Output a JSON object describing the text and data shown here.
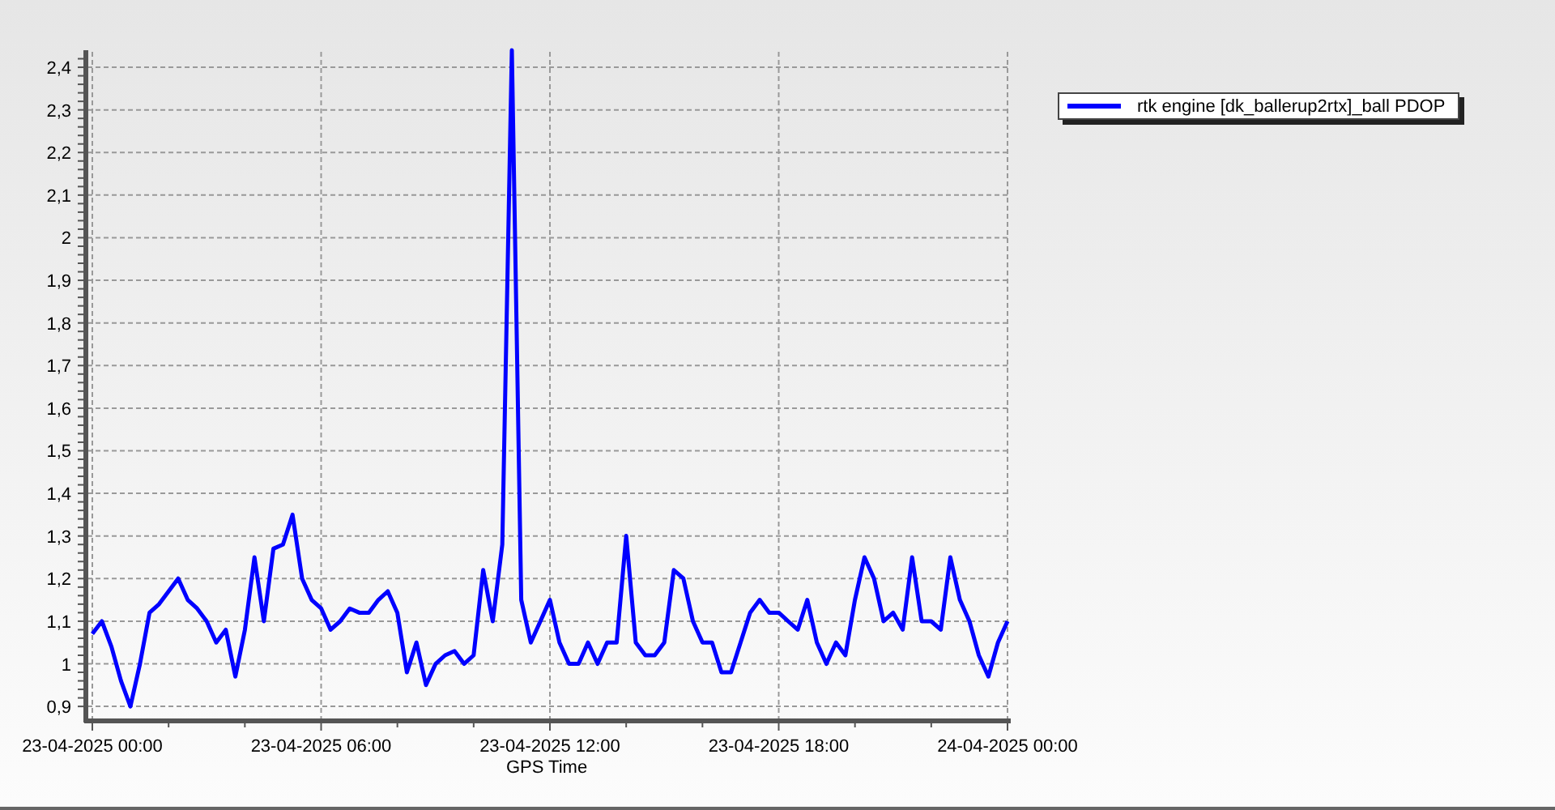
{
  "chart_data": {
    "type": "line",
    "xlabel": "GPS Time",
    "grid": true,
    "categories": [
      "23-04-2025 00:00",
      null,
      null,
      null,
      null,
      null,
      null,
      null,
      null,
      null,
      null,
      null,
      null,
      null,
      null,
      null,
      null,
      null,
      null,
      null,
      null,
      null,
      null,
      null,
      "23-04-2025 06:00",
      null,
      null,
      null,
      null,
      null,
      null,
      null,
      null,
      null,
      null,
      null,
      null,
      null,
      null,
      null,
      null,
      null,
      null,
      null,
      null,
      null,
      null,
      null,
      "23-04-2025 12:00",
      null,
      null,
      null,
      null,
      null,
      null,
      null,
      null,
      null,
      null,
      null,
      null,
      null,
      null,
      null,
      null,
      null,
      null,
      null,
      null,
      null,
      null,
      null,
      "23-04-2025 18:00",
      null,
      null,
      null,
      null,
      null,
      null,
      null,
      null,
      null,
      null,
      null,
      null,
      null,
      null,
      null,
      null,
      null,
      null,
      null,
      null,
      null,
      null,
      null,
      "24-04-2025 00:00"
    ],
    "yticks": [
      {
        "value": 0.9,
        "label": "0,9"
      },
      {
        "value": 1,
        "label": "1"
      },
      {
        "value": 1.1,
        "label": "1,1"
      },
      {
        "value": 1.2,
        "label": "1,2"
      },
      {
        "value": 1.3,
        "label": "1,3"
      },
      {
        "value": 1.4,
        "label": "1,4"
      },
      {
        "value": 1.5,
        "label": "1,5"
      },
      {
        "value": 1.6,
        "label": "1,6"
      },
      {
        "value": 1.7,
        "label": "1,7"
      },
      {
        "value": 1.8,
        "label": "1,8"
      },
      {
        "value": 1.9,
        "label": "1,9"
      },
      {
        "value": 2,
        "label": "2"
      },
      {
        "value": 2.1,
        "label": "2,1"
      },
      {
        "value": 2.2,
        "label": "2,2"
      },
      {
        "value": 2.3,
        "label": "2,3"
      },
      {
        "value": 2.4,
        "label": "2,4"
      }
    ],
    "ylim": [
      0.866,
      2.44
    ],
    "series": [
      {
        "name": "rtk engine [dk_ballerup2rtx]_ball PDOP",
        "color": "#0000ff",
        "values": [
          1.07,
          1.1,
          1.04,
          0.96,
          0.9,
          1.0,
          1.12,
          1.14,
          1.17,
          1.2,
          1.15,
          1.13,
          1.1,
          1.05,
          1.08,
          0.97,
          1.08,
          1.25,
          1.1,
          1.27,
          1.28,
          1.35,
          1.2,
          1.15,
          1.13,
          1.08,
          1.1,
          1.13,
          1.12,
          1.12,
          1.15,
          1.17,
          1.12,
          0.98,
          1.05,
          0.95,
          1.0,
          1.02,
          1.03,
          1.0,
          1.02,
          1.22,
          1.1,
          1.28,
          2.44,
          1.15,
          1.05,
          1.1,
          1.15,
          1.05,
          1.0,
          1.0,
          1.05,
          1.0,
          1.05,
          1.05,
          1.3,
          1.05,
          1.02,
          1.02,
          1.05,
          1.22,
          1.2,
          1.1,
          1.05,
          1.05,
          0.98,
          0.98,
          1.05,
          1.12,
          1.15,
          1.12,
          1.12,
          1.1,
          1.08,
          1.15,
          1.05,
          1.0,
          1.05,
          1.02,
          1.15,
          1.25,
          1.2,
          1.1,
          1.12,
          1.08,
          1.25,
          1.1,
          1.1,
          1.08,
          1.25,
          1.15,
          1.1,
          1.02,
          0.97,
          1.05,
          1.1
        ]
      }
    ]
  }
}
